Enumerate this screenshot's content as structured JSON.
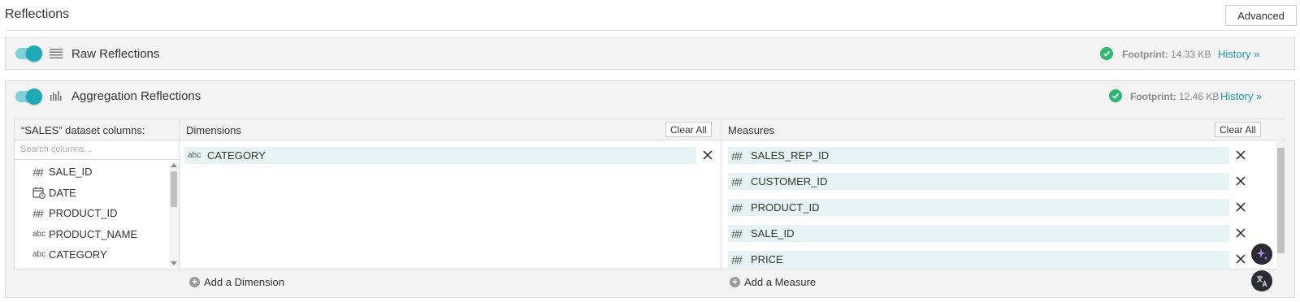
{
  "header": {
    "title": "Reflections",
    "advanced_label": "Advanced"
  },
  "raw": {
    "label": "Raw Reflections",
    "footprint_label": "Footprint:",
    "footprint_value": "14.33 KB",
    "history_label": "History »",
    "enabled": true
  },
  "aggregation": {
    "label": "Aggregation Reflections",
    "footprint_label": "Footprint:",
    "footprint_value": "12.46 KB",
    "history_label": "History »",
    "enabled": true,
    "columns_header": "“SALES” dataset columns:",
    "search_placeholder": "Search columns...",
    "columns": [
      {
        "type": "##",
        "name": "SALE_ID"
      },
      {
        "type": "date",
        "name": "DATE"
      },
      {
        "type": "##",
        "name": "PRODUCT_ID"
      },
      {
        "type": "abc",
        "name": "PRODUCT_NAME"
      },
      {
        "type": "abc",
        "name": "CATEGORY"
      }
    ],
    "dimensions_header": "Dimensions",
    "dimensions_clear": "Clear All",
    "dimensions": [
      {
        "type": "abc",
        "name": "CATEGORY"
      }
    ],
    "add_dimension": "Add a Dimension",
    "measures_header": "Measures",
    "measures_clear": "Clear All",
    "measures": [
      {
        "type": "##",
        "name": "SALES_REP_ID"
      },
      {
        "type": "##",
        "name": "CUSTOMER_ID"
      },
      {
        "type": "##",
        "name": "PRODUCT_ID"
      },
      {
        "type": "##",
        "name": "SALE_ID"
      },
      {
        "type": "##",
        "name": "PRICE"
      }
    ],
    "add_measure": "Add a Measure"
  },
  "type_glyphs": {
    "hash": "##",
    "abc": "abc"
  },
  "colors": {
    "accent": "#1fa9b5",
    "success": "#2eb872",
    "pill": "#e6f4f6"
  }
}
